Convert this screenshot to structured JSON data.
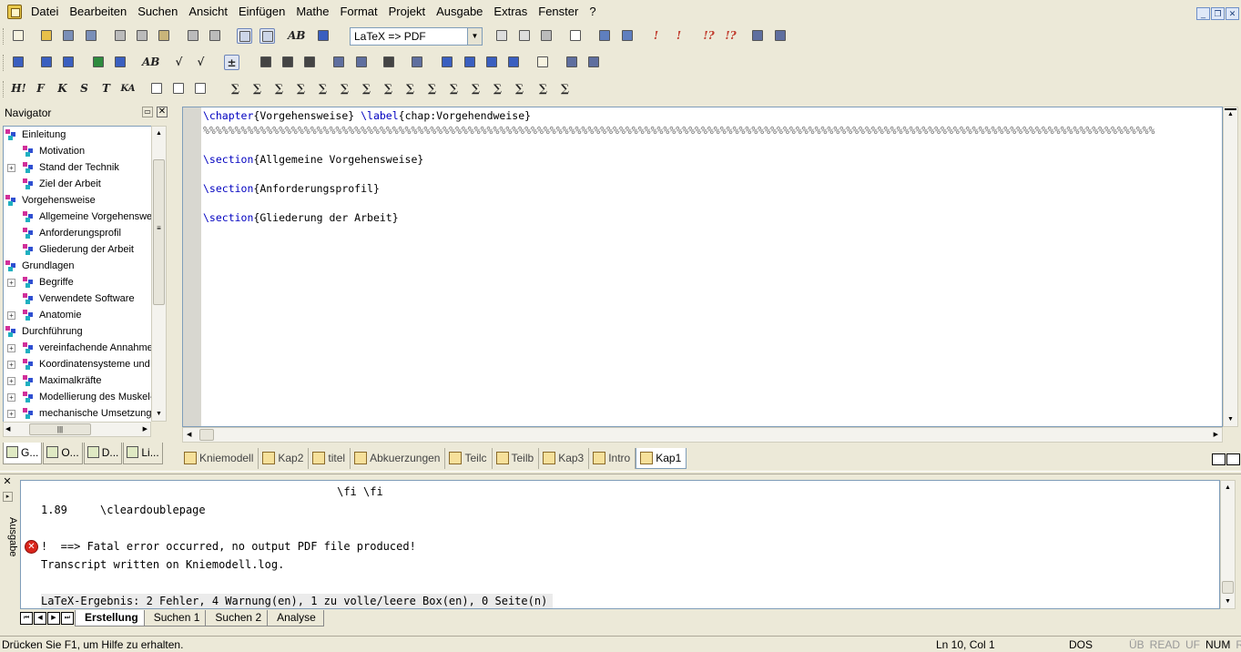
{
  "menu": [
    "Datei",
    "Bearbeiten",
    "Suchen",
    "Ansicht",
    "Einfügen",
    "Mathe",
    "Format",
    "Projekt",
    "Ausgabe",
    "Extras",
    "Fenster",
    "?"
  ],
  "toolbar": {
    "build_profile": "LaTeX => PDF"
  },
  "navigator": {
    "title": "Navigator",
    "items": [
      {
        "label": "Einleitung",
        "level": 0,
        "expander": false
      },
      {
        "label": "Motivation",
        "level": 1,
        "expander": false
      },
      {
        "label": "Stand der Technik",
        "level": 1,
        "expander": true
      },
      {
        "label": "Ziel der Arbeit",
        "level": 1,
        "expander": false
      },
      {
        "label": "Vorgehensweise",
        "level": 0,
        "expander": false
      },
      {
        "label": "Allgemeine Vorgehensweise",
        "level": 1,
        "expander": false
      },
      {
        "label": "Anforderungsprofil",
        "level": 1,
        "expander": false
      },
      {
        "label": "Gliederung der Arbeit",
        "level": 1,
        "expander": false
      },
      {
        "label": "Grundlagen",
        "level": 0,
        "expander": false
      },
      {
        "label": "Begriffe",
        "level": 1,
        "expander": true
      },
      {
        "label": "Verwendete Software",
        "level": 1,
        "expander": false
      },
      {
        "label": "Anatomie",
        "level": 1,
        "expander": true
      },
      {
        "label": "Durchführung",
        "level": 0,
        "expander": false
      },
      {
        "label": "vereinfachende Annahmen",
        "level": 1,
        "expander": true
      },
      {
        "label": "Koordinatensysteme und",
        "level": 1,
        "expander": true
      },
      {
        "label": "Maximalkräfte",
        "level": 1,
        "expander": true
      },
      {
        "label": "Modellierung des Muskel-",
        "level": 1,
        "expander": true
      },
      {
        "label": "mechanische Umsetzung",
        "level": 1,
        "expander": true
      }
    ],
    "tabs": [
      "G...",
      "O...",
      "D...",
      "Li..."
    ]
  },
  "editor": {
    "lines": [
      [
        {
          "t": "\\chapter",
          "c": "cmd"
        },
        {
          "t": "{Vorgehensweise} ",
          "c": ""
        },
        {
          "t": "\\label",
          "c": "cmd"
        },
        {
          "t": "{chap:Vorgehendweise}",
          "c": ""
        }
      ],
      [
        {
          "t": "%%%%%%%%%%%%%%%%%%%%%%%%%%%%%%%%%%%%%%%%%%%%%%%%%%%%%%%%%%%%%%%%%%%%%%%%%%%%%%%%%%%%%%%%%%%%%%%%%%%%%%%%%%%%%%%%%%%%%%%%%%%%%%%%%%%%%%%%%%%%%%%%%%%%%%%",
          "c": "pct"
        }
      ],
      [],
      [
        {
          "t": "\\section",
          "c": "cmd"
        },
        {
          "t": "{Allgemeine Vorgehensweise}",
          "c": ""
        }
      ],
      [],
      [
        {
          "t": "\\section",
          "c": "cmd"
        },
        {
          "t": "{Anforderungsprofil}",
          "c": ""
        }
      ],
      [],
      [
        {
          "t": "\\section",
          "c": "cmd"
        },
        {
          "t": "{Gliederung der Arbeit}",
          "c": ""
        }
      ]
    ]
  },
  "doc_tabs": [
    {
      "label": "Kniemodell",
      "active": false
    },
    {
      "label": "Kap2",
      "active": false
    },
    {
      "label": "titel",
      "active": false
    },
    {
      "label": "Abkuerzungen",
      "active": false
    },
    {
      "label": "Teilc",
      "active": false
    },
    {
      "label": "Teilb",
      "active": false
    },
    {
      "label": "Kap3",
      "active": false
    },
    {
      "label": "Intro",
      "active": false
    },
    {
      "label": "Kap1",
      "active": true
    }
  ],
  "output": {
    "panel_label": "Ausgabe",
    "lines": [
      {
        "text": "                                             \\fi \\fi",
        "error": false
      },
      {
        "text": "1.89     \\cleardoublepage",
        "error": false
      },
      {
        "text": "",
        "error": false
      },
      {
        "text": "!  ==> Fatal error occurred, no output PDF file produced!",
        "error": true
      },
      {
        "text": "Transcript written on Kniemodell.log.",
        "error": false
      },
      {
        "text": "",
        "error": false
      },
      {
        "text": "LaTeX-Ergebnis: 2 Fehler, 4 Warnung(en), 1 zu volle/leere Box(en), 0 Seite(n)",
        "error": false
      }
    ],
    "tabs": [
      {
        "label": "Erstellung",
        "active": true
      },
      {
        "label": "Suchen 1",
        "active": false
      },
      {
        "label": "Suchen 2",
        "active": false
      },
      {
        "label": "Analyse",
        "active": false
      }
    ]
  },
  "status": {
    "help": "Drücken Sie F1, um Hilfe zu erhalten.",
    "position": "Ln 10, Col 1",
    "encoding": "DOS",
    "flags": [
      {
        "label": "ÜB",
        "on": false
      },
      {
        "label": "READ",
        "on": false
      },
      {
        "label": "UF",
        "on": false
      },
      {
        "label": "NUM",
        "on": true
      },
      {
        "label": "RF",
        "on": false
      }
    ]
  },
  "colors": {
    "command": "#0000c0",
    "comment": "#6f6f6f",
    "error": "#d9251b",
    "chrome": "#ece9d8"
  }
}
